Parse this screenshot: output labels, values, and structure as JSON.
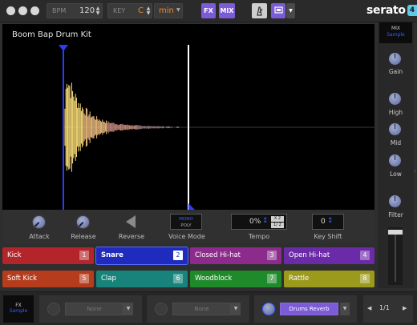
{
  "topbar": {
    "bpm_label": "BPM",
    "bpm_value": "120",
    "key_label": "KEY",
    "key_value": "C",
    "key_mode": "min",
    "fx_button": "FX",
    "mix_button": "MIX",
    "brand": "serato"
  },
  "waveform": {
    "title": "Boom Bap Drum Kit"
  },
  "controls": {
    "attack_label": "Attack",
    "release_label": "Release",
    "reverse_label": "Reverse",
    "voice_mode_label": "Voice Mode",
    "voice_mode_mono": "MONO",
    "voice_mode_poly": "POLY",
    "tempo_label": "Tempo",
    "tempo_value": "0%",
    "tempo_x2": "X 2",
    "tempo_half": "1/ 2",
    "key_shift_label": "Key Shift",
    "key_shift_value": "0"
  },
  "pads": [
    {
      "label": "Kick",
      "num": "1",
      "color": "#b3252a",
      "active": false
    },
    {
      "label": "Snare",
      "num": "2",
      "color": "#1f2bbd",
      "active": true
    },
    {
      "label": "Closed Hi-hat",
      "num": "3",
      "color": "#8c2b8c",
      "active": false
    },
    {
      "label": "Open Hi-hat",
      "num": "4",
      "color": "#6b2aa8",
      "active": false
    },
    {
      "label": "Soft Kick",
      "num": "5",
      "color": "#b53d1e",
      "active": false
    },
    {
      "label": "Clap",
      "num": "6",
      "color": "#18837a",
      "active": false
    },
    {
      "label": "Woodblock",
      "num": "7",
      "color": "#1f8a2a",
      "active": false
    },
    {
      "label": "Rattle",
      "num": "8",
      "color": "#9c9a1c",
      "active": false
    }
  ],
  "mixer": {
    "header_top": "MIX",
    "header_sub": "Sample",
    "gain_label": "Gain",
    "high_label": "High",
    "mid_label": "Mid",
    "low_label": "Low",
    "filter_label": "Filter"
  },
  "fxbar": {
    "fx_label": "FX",
    "fx_sub": "Sample",
    "slot1": "None",
    "slot2": "None",
    "slot3": "Drums Reverb",
    "page": "1/1"
  },
  "colors": {
    "accent_purple": "#7b5cd6",
    "accent_blue": "#3a5cff",
    "playhead": "#ffffff",
    "brand_badge": "#5ec8e8"
  }
}
